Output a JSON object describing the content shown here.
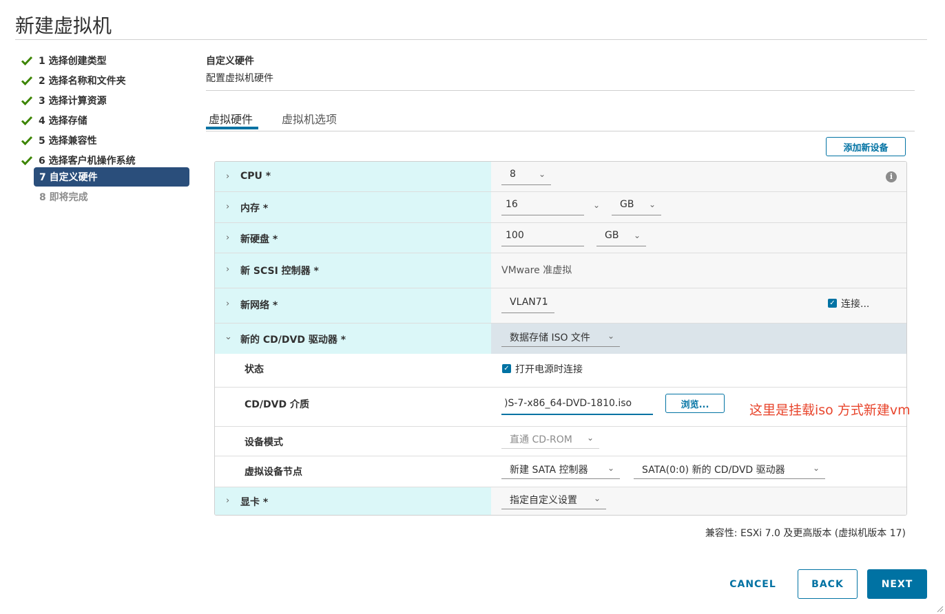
{
  "window": {
    "title": "新建虚拟机"
  },
  "steps": [
    {
      "label": "1 选择创建类型",
      "state": "done"
    },
    {
      "label": "2 选择名称和文件夹",
      "state": "done"
    },
    {
      "label": "3 选择计算资源",
      "state": "done"
    },
    {
      "label": "4 选择存储",
      "state": "done"
    },
    {
      "label": "5 选择兼容性",
      "state": "done"
    },
    {
      "label": "6 选择客户机操作系统",
      "state": "done"
    },
    {
      "label": "7 自定义硬件",
      "state": "active"
    },
    {
      "label": "8 即将完成",
      "state": "pending"
    }
  ],
  "section": {
    "title": "自定义硬件",
    "subtitle": "配置虚拟机硬件"
  },
  "tabs": [
    {
      "label": "虚拟硬件",
      "selected": true
    },
    {
      "label": "虚拟机选项",
      "selected": false
    }
  ],
  "add_device_label": "添加新设备",
  "hardware": {
    "cpu": {
      "label": "CPU *",
      "value": "8"
    },
    "memory": {
      "label": "内存 *",
      "value": "16",
      "unit": "GB"
    },
    "disk": {
      "label": "新硬盘 *",
      "value": "100",
      "unit": "GB"
    },
    "scsi": {
      "label": "新 SCSI 控制器 *",
      "value": "VMware 准虚拟"
    },
    "network": {
      "label": "新网络 *",
      "value": "VLAN71",
      "connect_label": "连接...",
      "connected": true
    },
    "cdrom": {
      "label": "新的 CD/DVD 驱动器 *",
      "value": "数据存储 ISO 文件",
      "status_label": "状态",
      "status_check_label": "打开电源时连接",
      "status_checked": true,
      "media_label": "CD/DVD 介质",
      "media_value": ")S-7-x86_64-DVD-1810.iso",
      "browse_label": "浏览...",
      "mode_label": "设备模式",
      "mode_value": "直通 CD-ROM",
      "node_label": "虚拟设备节点",
      "node_controller": "新建 SATA 控制器",
      "node_value": "SATA(0:0) 新的 CD/DVD 驱动器"
    },
    "video": {
      "label": "显卡 *",
      "value": "指定自定义设置"
    }
  },
  "annotation": "这里是挂载iso 方式新建vm",
  "compatibility": "兼容性: ESXi 7.0 及更高版本 (虚拟机版本 17)",
  "buttons": {
    "cancel": "CANCEL",
    "back": "BACK",
    "next": "NEXT"
  },
  "colors": {
    "accent": "#0072a3",
    "active_step_bg": "#2a4e7b",
    "row_label_bg": "#dbf7f8",
    "check_green": "#3c8500",
    "annotation": "#e8452c"
  },
  "icons": [
    "check-icon",
    "chevron-right-icon",
    "chevron-down-icon",
    "info-icon",
    "checkbox-checked-icon"
  ]
}
